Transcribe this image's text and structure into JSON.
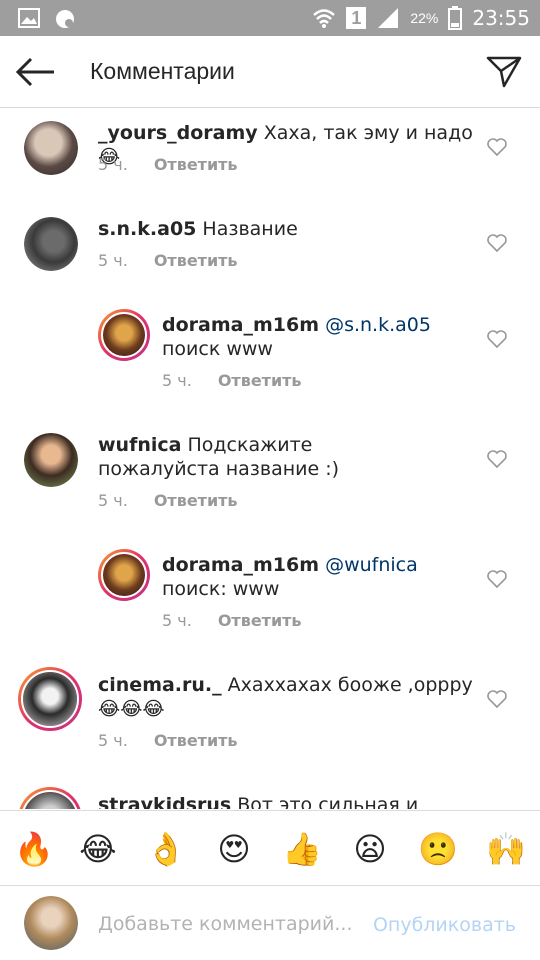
{
  "status_bar": {
    "battery_percent": "22%",
    "time": "23:55",
    "sim_label": "1"
  },
  "header": {
    "title": "Комментарии"
  },
  "comments": [
    {
      "user": "_yours_doramy",
      "text": " Хаха, так эму и надо😂",
      "mention": "",
      "time": "5 ч.",
      "reply_label": "Ответить"
    },
    {
      "user": "s.n.k.a05",
      "text": " Название",
      "mention": "",
      "time": "5 ч.",
      "reply_label": "Ответить"
    },
    {
      "user": "dorama_m16m",
      "mention": "@s.n.k.a05",
      "text": " поиск www",
      "time": "5 ч.",
      "reply_label": "Ответить"
    },
    {
      "user": "wufnica",
      "text": " Подскажите пожалуйста название :)",
      "mention": "",
      "time": "5 ч.",
      "reply_label": "Ответить"
    },
    {
      "user": "dorama_m16m",
      "mention": "@wufnica",
      "text": " поиск: www",
      "time": "5 ч.",
      "reply_label": "Ответить"
    },
    {
      "user": "cinema.ru._",
      "text": " Ахаххахах бооже ,орррy 😂😂😂",
      "mention": "",
      "time": "5 ч.",
      "reply_label": "Ответить"
    },
    {
      "user": "stravkidsrus",
      "text": " Вот это сильная и",
      "mention": "",
      "time": "",
      "reply_label": ""
    }
  ],
  "emoji_bar": [
    "🔥",
    "😂",
    "👌",
    "😍",
    "👍",
    "😦",
    "🙁",
    "🙌"
  ],
  "composer": {
    "placeholder": "Добавьте комментарий...",
    "publish_label": "Опубликовать"
  },
  "colors": {
    "status_bar": "#9e9e9e",
    "mention": "#003569",
    "meta": "#999999",
    "publish_disabled": "#b3d4f5"
  }
}
